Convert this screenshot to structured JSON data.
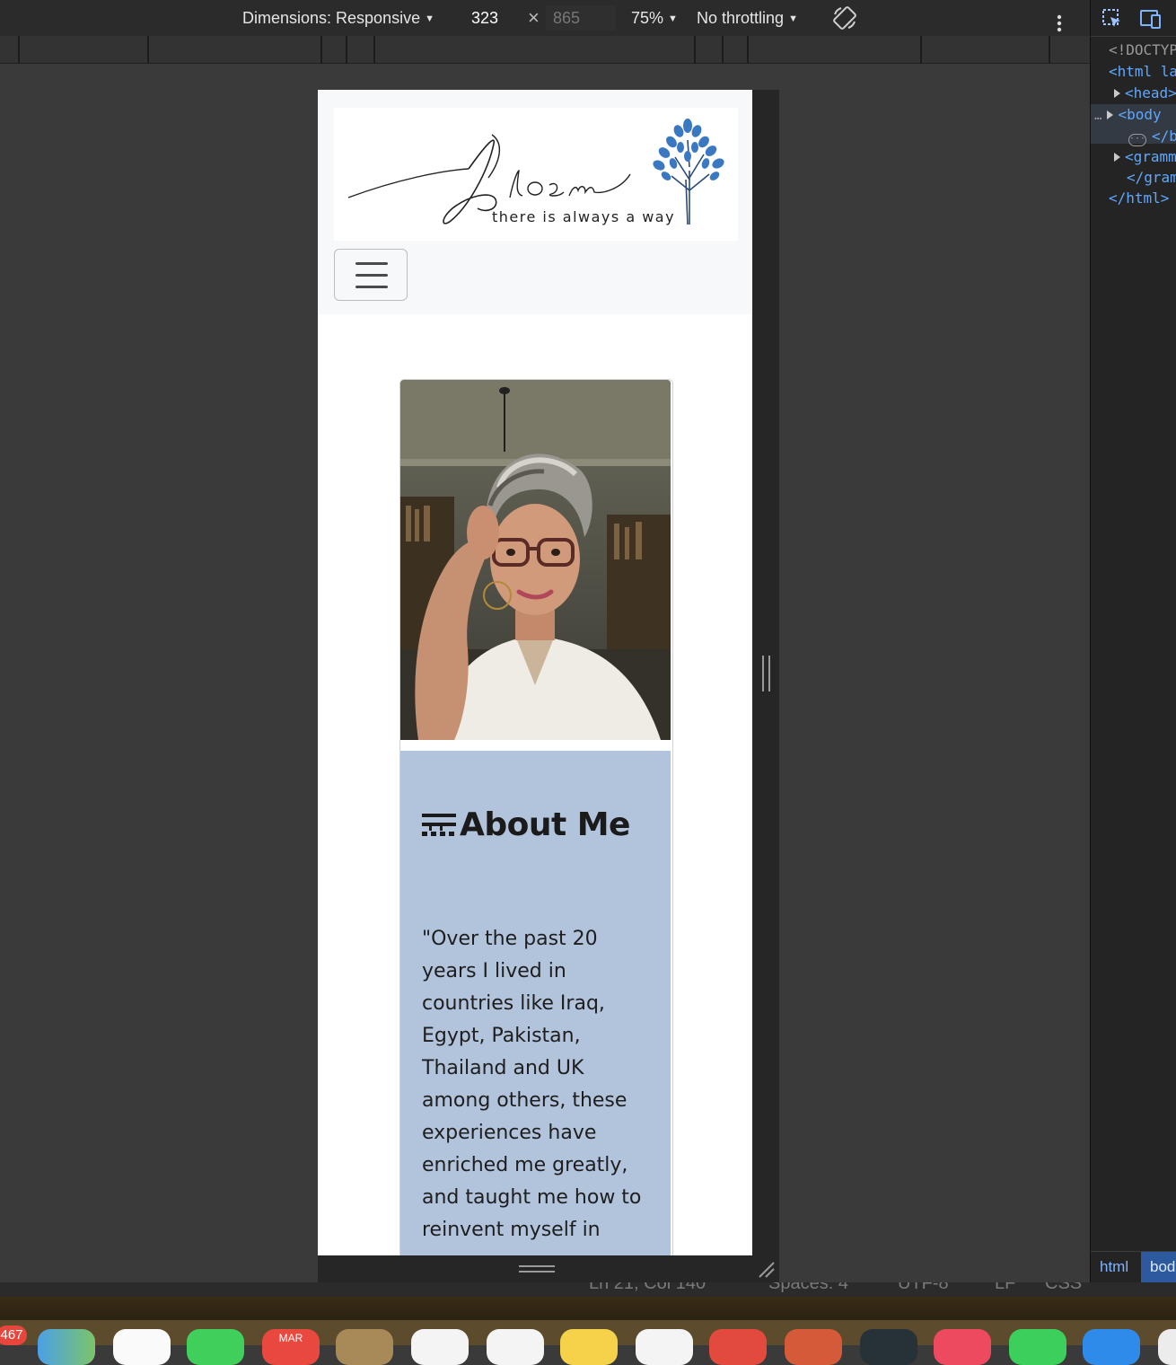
{
  "devtools": {
    "dimensions_label": "Dimensions: Responsive",
    "width_value": "323",
    "times": "×",
    "height_value": "865",
    "zoom": "75%",
    "throttling": "No throttling",
    "elements_lines": [
      "<!DOCTYPE",
      "<html la",
      "<head>",
      "<body",
      "</b",
      "<gramm",
      "</gram",
      "</html>"
    ],
    "ellipsis": "…",
    "breadcrumbs": [
      "html",
      "bod"
    ]
  },
  "site": {
    "logo_text": "Blosm",
    "tagline": "there is always a way",
    "about_title": "About Me",
    "quote": "\"Over the past 20 years I lived in countries like Iraq, Egypt, Pakistan, Thailand and UK among others, these experiences have enriched me greatly, and taught me how to reinvent myself in"
  },
  "editor_status": {
    "position": "Ln 21, Col 140",
    "spaces": "Spaces: 4",
    "encoding": "UTF-8",
    "eol": "LF",
    "language": "CSS"
  },
  "dock": {
    "mail_badge": "467",
    "calendar_month": "MAR"
  },
  "colors": {
    "card_body": "#b2c3dc",
    "logo_tree": "#3b78c2",
    "devtools_bg": "#2b2b2b"
  }
}
